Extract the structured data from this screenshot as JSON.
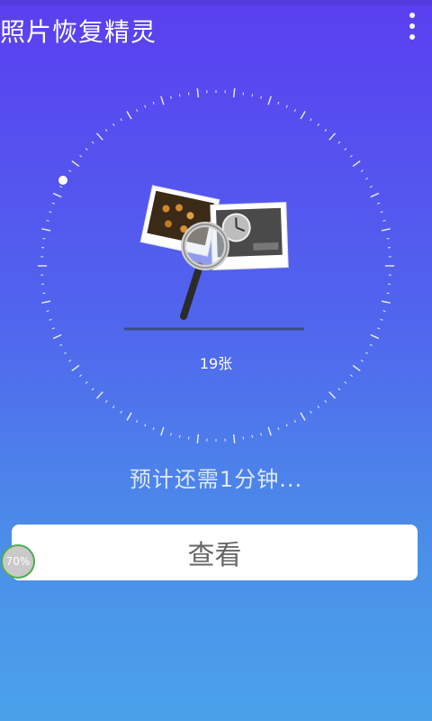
{
  "header": {
    "title": "照片恢复精灵",
    "menu_icon": "overflow-menu-icon"
  },
  "scan": {
    "count_label": "19张",
    "eta_text": "预计还需1分钟...",
    "illustration_icon": "photo-magnifier-icon"
  },
  "actions": {
    "view_label": "查看"
  },
  "progress": {
    "label": "70%",
    "value": 0.7
  },
  "colors": {
    "background_top": "#5a3ff0",
    "background_bottom": "#4aa2ea",
    "progress_ring": "#4cae4c"
  }
}
